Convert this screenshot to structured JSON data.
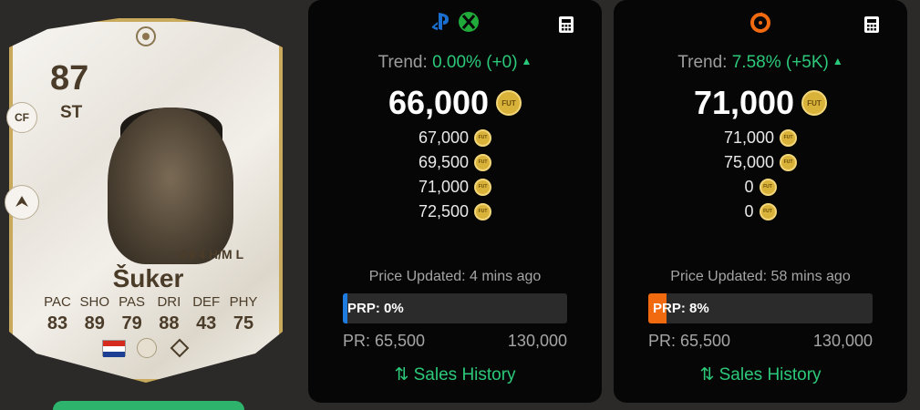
{
  "card": {
    "rating": "87",
    "position": "ST",
    "alt_position": "CF",
    "skills_line": "4★4 H/M L",
    "name": "Šuker",
    "stat_labels": [
      "PAC",
      "SHO",
      "PAS",
      "DRI",
      "DEF",
      "PHY"
    ],
    "stat_values": [
      "83",
      "89",
      "79",
      "88",
      "43",
      "75"
    ],
    "nation_icon": "croatia-flag-icon",
    "league_icon": "icons-league-icon",
    "club_icon": "icons-club-icon"
  },
  "coin_label": "FUT",
  "console": {
    "platform_icons": [
      "playstation-icon",
      "xbox-icon"
    ],
    "trend_label": "Trend: ",
    "trend_value": "0.00% (+0)",
    "price": "66,000",
    "sub_prices": [
      "67,000",
      "69,500",
      "71,000",
      "72,500"
    ],
    "updated": "Price Updated: 4 mins ago",
    "prp_label": "PRP: 0%",
    "prp_percent": 0,
    "prp_color": "#1e7be0",
    "pr_min": "PR: 65,500",
    "pr_max": "130,000",
    "sales_label": "⇅ Sales History"
  },
  "pc": {
    "platform_icons": [
      "origin-icon"
    ],
    "trend_label": "Trend: ",
    "trend_value": "7.58% (+5K)",
    "price": "71,000",
    "sub_prices": [
      "71,000",
      "75,000",
      "0",
      "0"
    ],
    "updated": "Price Updated: 58 mins ago",
    "prp_label": "PRP: 8%",
    "prp_percent": 8,
    "prp_color": "#f26a10",
    "pr_min": "PR: 65,500",
    "pr_max": "130,000",
    "sales_label": "⇅ Sales History"
  }
}
